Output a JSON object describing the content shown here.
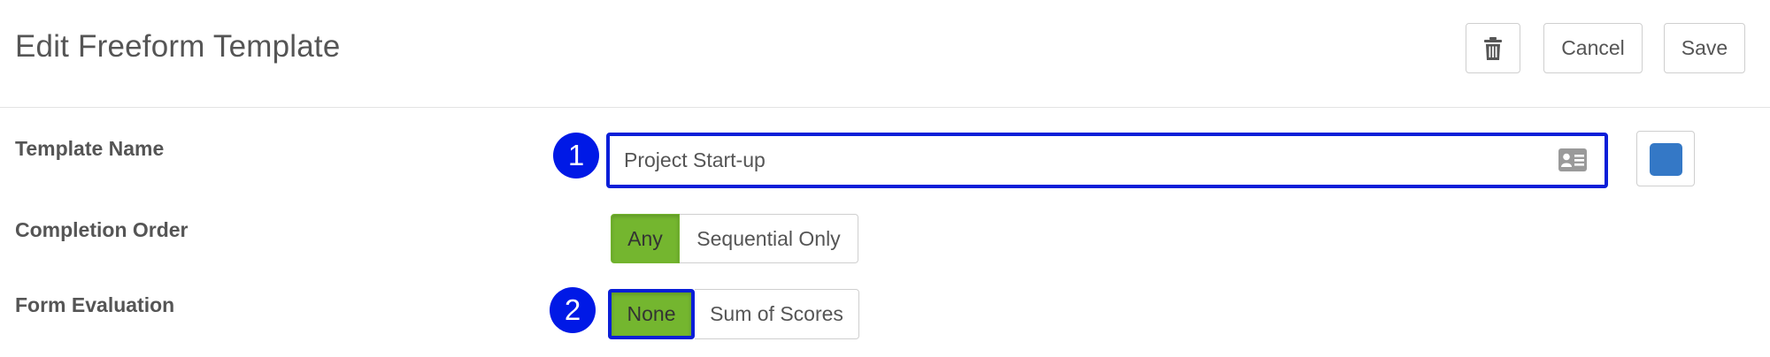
{
  "header": {
    "title": "Edit Freeform Template",
    "delete_icon": "trash-icon",
    "cancel_label": "Cancel",
    "save_label": "Save"
  },
  "template_name": {
    "label": "Template Name",
    "callout": "1",
    "value": "Project Start-up",
    "field_icon": "contact-card-icon",
    "color": "#3478c6"
  },
  "completion_order": {
    "label": "Completion Order",
    "options": [
      "Any",
      "Sequential Only"
    ],
    "selected": "Any"
  },
  "form_evaluation": {
    "label": "Form Evaluation",
    "callout": "2",
    "options": [
      "None",
      "Sum of Scores"
    ],
    "selected": "None"
  },
  "colors": {
    "active_segment": "#74b62f",
    "callout": "#0019e6",
    "highlight_border": "#0a1ed8"
  }
}
